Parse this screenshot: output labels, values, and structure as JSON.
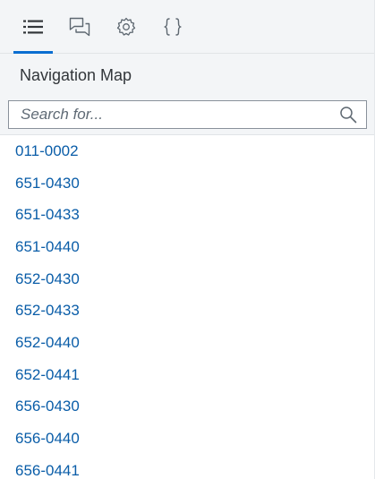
{
  "toolbar": {
    "tabs": [
      {
        "icon": "list-icon",
        "active": true
      },
      {
        "icon": "comment-icon",
        "active": false
      },
      {
        "icon": "gear-icon",
        "active": false
      },
      {
        "icon": "braces-icon",
        "active": false
      }
    ]
  },
  "navigation": {
    "title": "Navigation Map"
  },
  "search": {
    "placeholder": "Search for...",
    "value": ""
  },
  "items": [
    {
      "label": "011-0002"
    },
    {
      "label": "651-0430"
    },
    {
      "label": "651-0433"
    },
    {
      "label": "651-0440"
    },
    {
      "label": "652-0430"
    },
    {
      "label": "652-0433"
    },
    {
      "label": "652-0440"
    },
    {
      "label": "652-0441"
    },
    {
      "label": "656-0430"
    },
    {
      "label": "656-0440"
    },
    {
      "label": "656-0441"
    }
  ],
  "colors": {
    "accent": "#0a6ed1",
    "link": "#0a5da8",
    "header_bg": "#f3f5f7",
    "text": "#32363a"
  }
}
